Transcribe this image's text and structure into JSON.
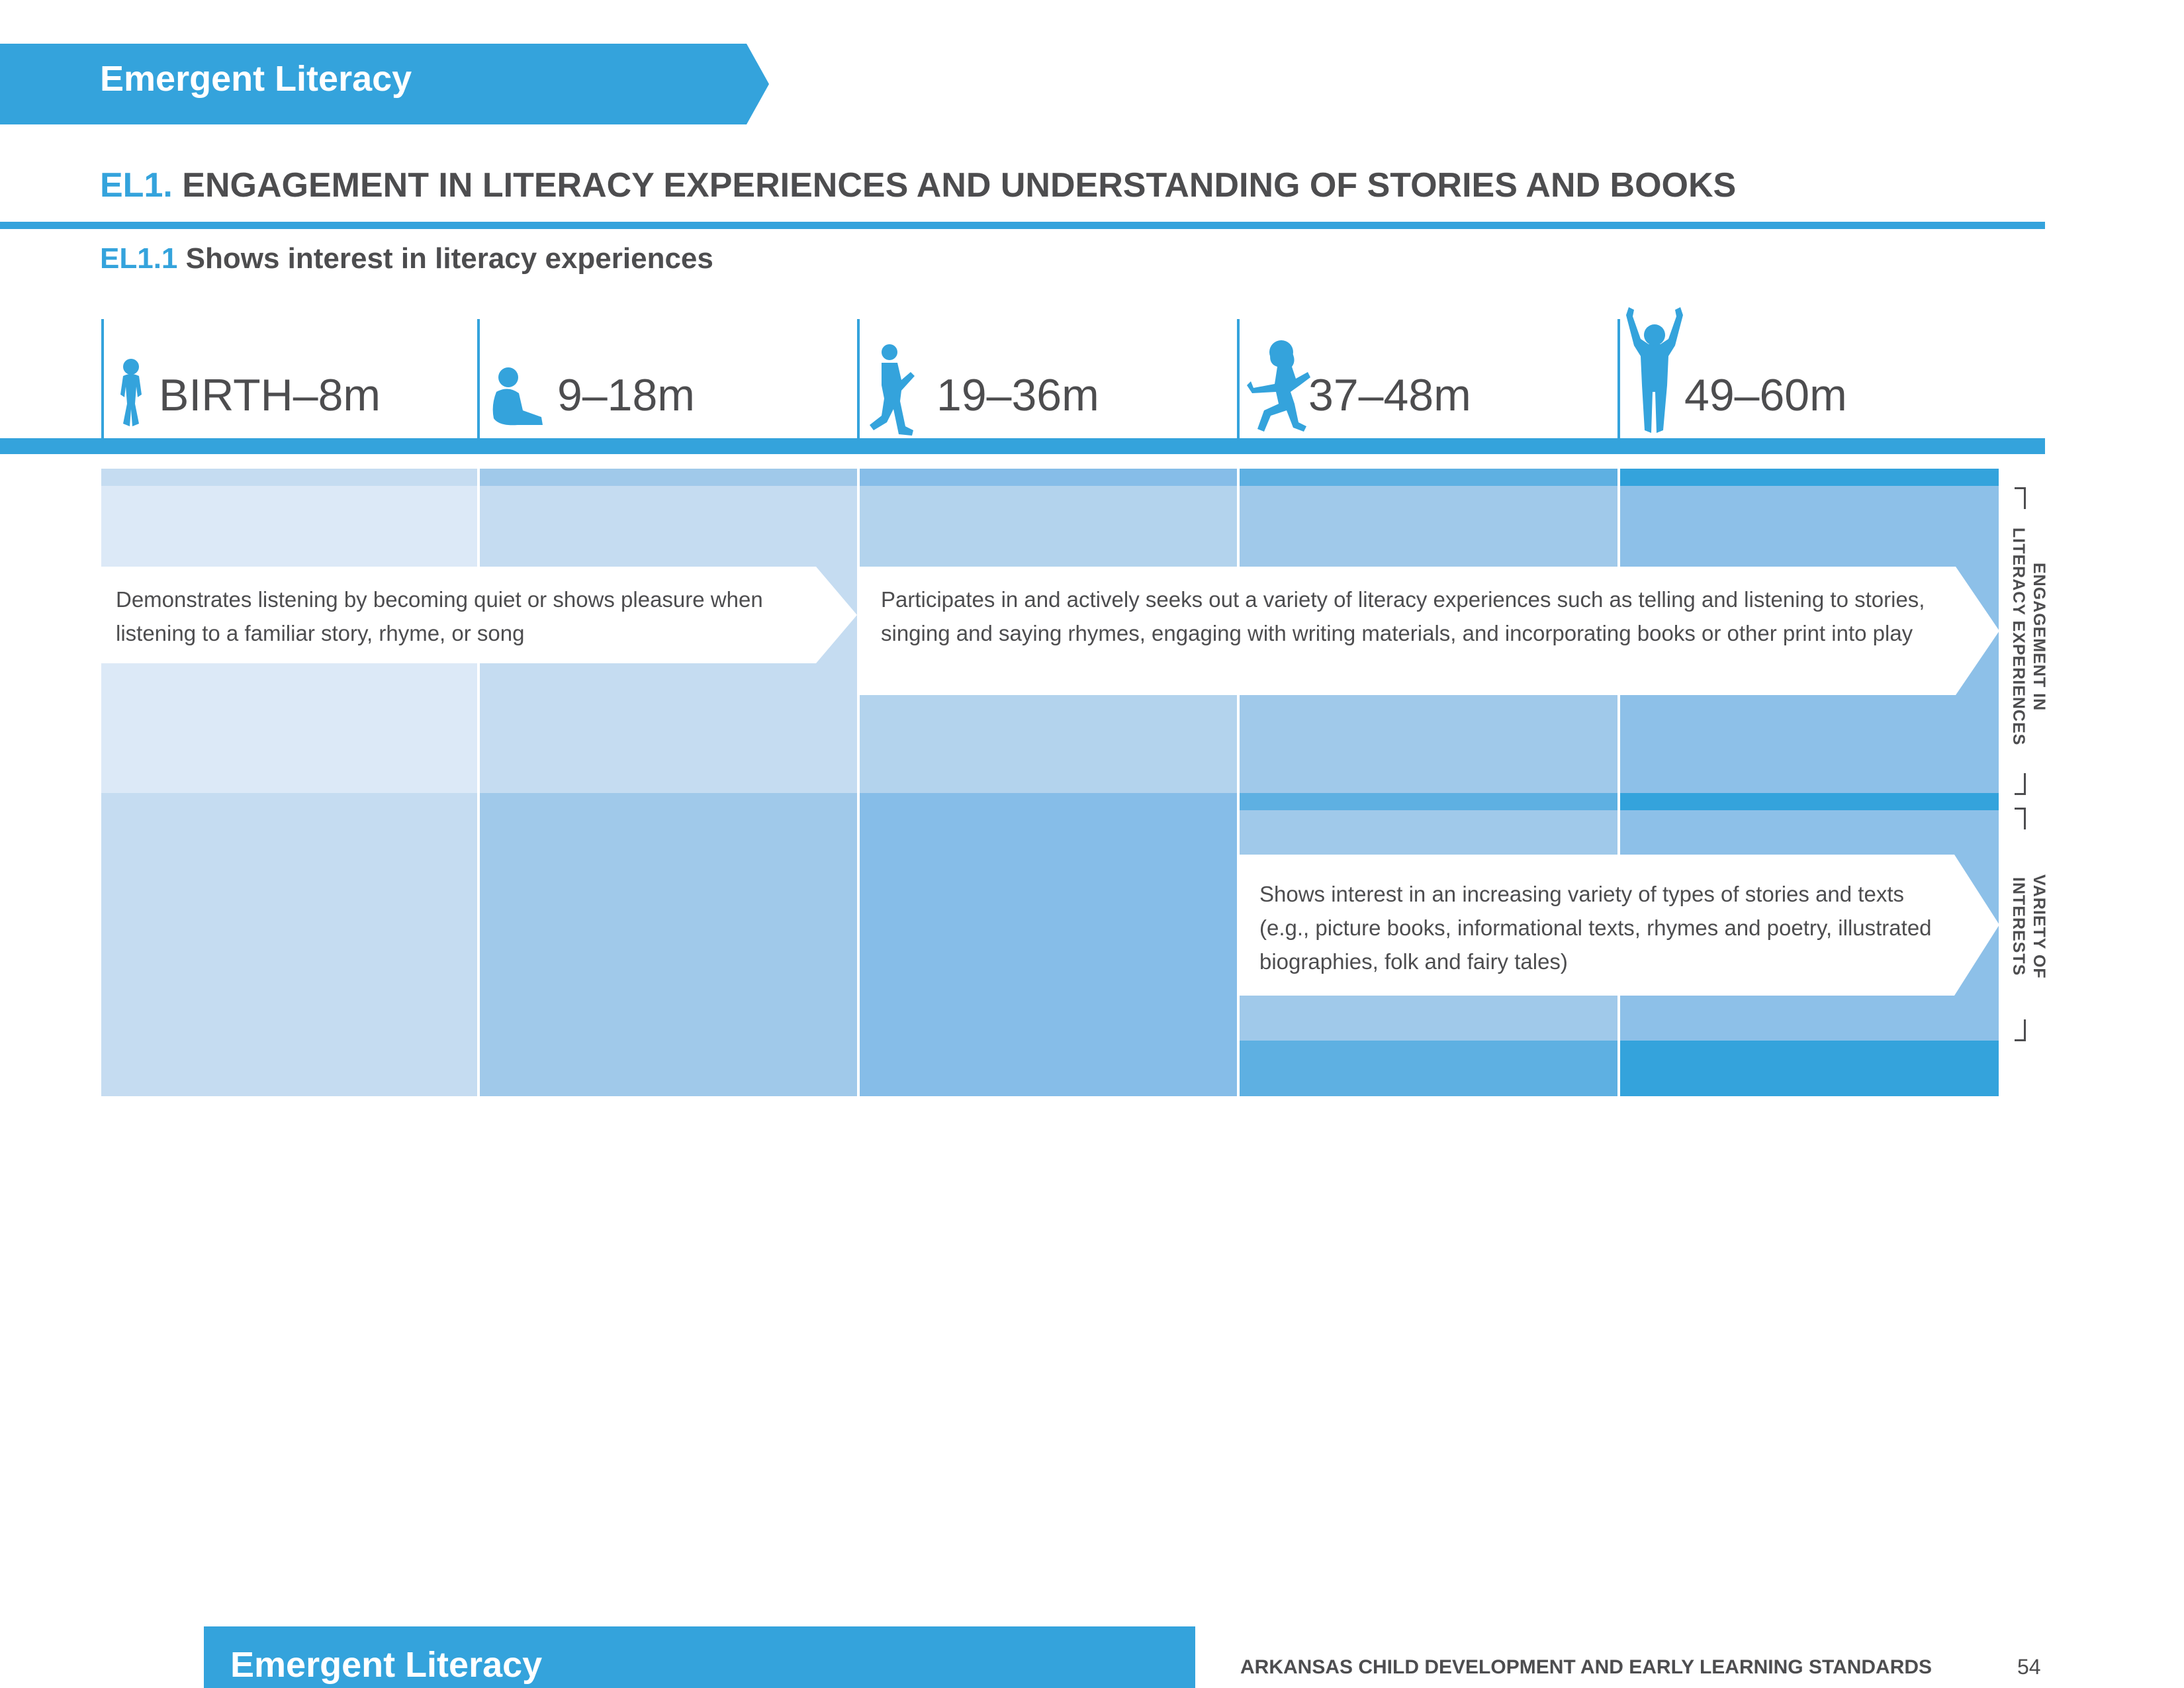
{
  "section": {
    "title": "Emergent Literacy"
  },
  "standard": {
    "code": "EL1.",
    "title": "ENGAGEMENT IN LITERACY EXPERIENCES AND UNDERSTANDING OF STORIES AND BOOKS"
  },
  "indicator": {
    "code": "EL1.1",
    "title": "Shows interest in literacy experiences"
  },
  "age_bands": [
    {
      "label": "BIRTH–8m",
      "icon": "infant-icon"
    },
    {
      "label": "9–18m",
      "icon": "sitting-baby-icon"
    },
    {
      "label": "19–36m",
      "icon": "walking-toddler-icon"
    },
    {
      "label": "37–48m",
      "icon": "running-child-icon"
    },
    {
      "label": "49–60m",
      "icon": "cheering-child-icon"
    }
  ],
  "rows": [
    {
      "label": "ENGAGEMENT IN LITERACY EXPERIENCES",
      "label_lines": [
        "ENGAGEMENT IN",
        "LITERACY EXPERIENCES"
      ],
      "descriptors": [
        {
          "text": "Demonstrates listening by becoming quiet or shows pleasure when listening to a familiar story, rhyme, or song"
        },
        {
          "text": "Participates in and actively seeks out a variety of literacy experiences such as telling and listening to stories, singing and saying rhymes, engaging with writing materials, and incorporating books or other print into play"
        }
      ]
    },
    {
      "label": "VARIETY OF INTERESTS",
      "label_lines": [
        "VARIETY OF",
        "INTERESTS"
      ],
      "descriptors": [
        {
          "text": "Shows interest in an increasing variety of  types of stories and texts (e.g., picture books, informational texts, rhymes and poetry, illustrated biographies, folk and fairy tales)"
        }
      ]
    }
  ],
  "colors": {
    "accent": "#34a3dc",
    "text": "#4d4d4f",
    "band_shades": [
      "#dce9f7",
      "#c5dcf1",
      "#b3d3ed",
      "#a0c9ea",
      "#8dc0e8"
    ]
  },
  "footer": {
    "section_title": "Emergent Literacy",
    "document_title": "ARKANSAS CHILD DEVELOPMENT AND EARLY LEARNING STANDARDS",
    "page_number": "54"
  }
}
